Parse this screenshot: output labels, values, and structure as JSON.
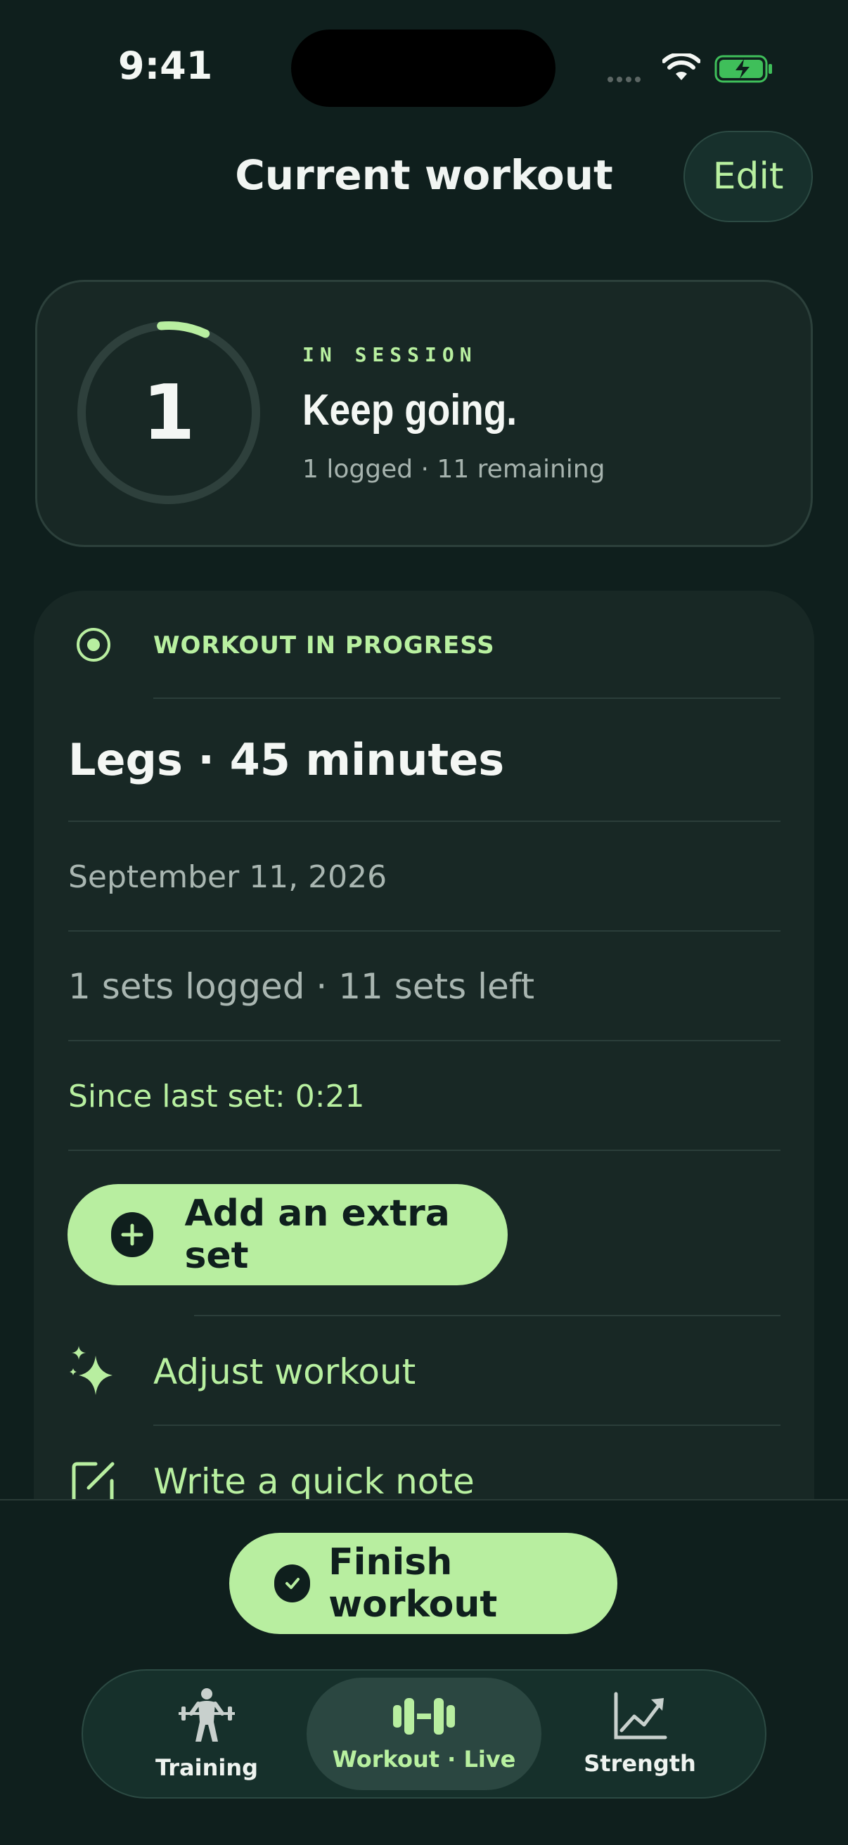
{
  "status_bar": {
    "time": "9:41"
  },
  "header": {
    "title": "Current workout",
    "edit_label": "Edit"
  },
  "session": {
    "progress_count": "1",
    "progress_fraction": 0.083,
    "eyebrow": "IN SESSION",
    "headline": "Keep going.",
    "summary": "1 logged · 11 remaining"
  },
  "workout": {
    "status": "WORKOUT IN PROGRESS",
    "title": "Legs · 45 minutes",
    "date": "September 11, 2026",
    "sets_line": "1 sets logged · 11 sets left",
    "since_last_set": "Since last set: 0:21",
    "add_set_label": "Add an extra set",
    "adjust_label": "Adjust workout",
    "note_label": "Write a quick note"
  },
  "actions": {
    "finish_label": "Finish workout"
  },
  "tabs": [
    {
      "label": "Training",
      "icon": "weightlifter-icon",
      "active": false
    },
    {
      "label": "Workout · Live",
      "icon": "dumbbell-icon",
      "active": true
    },
    {
      "label": "Strength",
      "icon": "chart-trend-icon",
      "active": false
    }
  ],
  "colors": {
    "background": "#0f1f1d",
    "card": "#182825",
    "accent": "#b8eea0",
    "muted_text": "#a9b6b1"
  }
}
